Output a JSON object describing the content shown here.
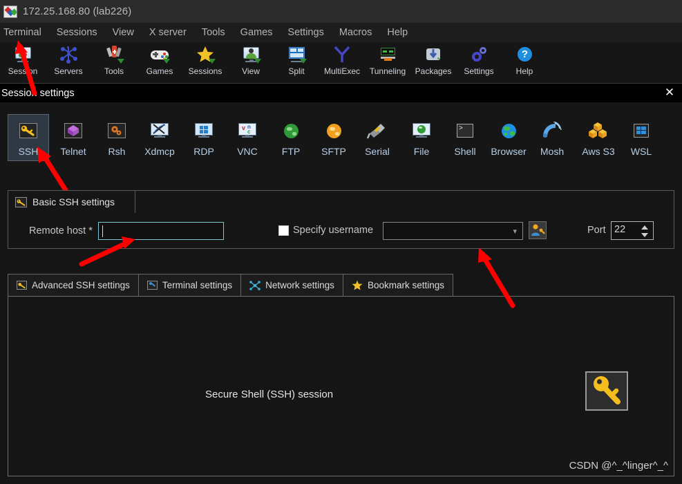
{
  "window": {
    "title": "172.25.168.80 (lab226)",
    "app_icon": "mobaxterm-logo-icon"
  },
  "menubar": {
    "items": [
      {
        "label": "Terminal"
      },
      {
        "label": "Sessions"
      },
      {
        "label": "View"
      },
      {
        "label": "X server"
      },
      {
        "label": "Tools"
      },
      {
        "label": "Games"
      },
      {
        "label": "Settings"
      },
      {
        "label": "Macros"
      },
      {
        "label": "Help"
      }
    ]
  },
  "toolbar": {
    "buttons": [
      {
        "label": "Session",
        "icon": "session-monitor-icon"
      },
      {
        "label": "Servers",
        "icon": "servers-network-icon"
      },
      {
        "label": "Tools",
        "icon": "tools-swiss-knife-icon"
      },
      {
        "label": "Games",
        "icon": "games-gamepad-icon"
      },
      {
        "label": "Sessions",
        "icon": "sessions-star-icon"
      },
      {
        "label": "View",
        "icon": "view-monitor-person-icon"
      },
      {
        "label": "Split",
        "icon": "split-panes-icon"
      },
      {
        "label": "MultiExec",
        "icon": "multiexec-fork-icon"
      },
      {
        "label": "Tunneling",
        "icon": "tunneling-arrows-icon"
      },
      {
        "label": "Packages",
        "icon": "packages-download-icon"
      },
      {
        "label": "Settings",
        "icon": "settings-gears-icon"
      },
      {
        "label": "Help",
        "icon": "help-question-icon"
      }
    ]
  },
  "session_dialog": {
    "header_title": "Session settings",
    "close_icon": "close-icon",
    "session_types": [
      {
        "label": "SSH",
        "icon": "ssh-key-icon",
        "selected": true
      },
      {
        "label": "Telnet",
        "icon": "telnet-cube-icon",
        "selected": false
      },
      {
        "label": "Rsh",
        "icon": "rsh-gears-icon",
        "selected": false
      },
      {
        "label": "Xdmcp",
        "icon": "xdmcp-x-monitor-icon",
        "selected": false
      },
      {
        "label": "RDP",
        "icon": "rdp-windows-icon",
        "selected": false
      },
      {
        "label": "VNC",
        "icon": "vnc-monitor-icon",
        "selected": false
      },
      {
        "label": "FTP",
        "icon": "ftp-green-globe-icon",
        "selected": false
      },
      {
        "label": "SFTP",
        "icon": "sftp-orange-globe-icon",
        "selected": false
      },
      {
        "label": "Serial",
        "icon": "serial-plug-icon",
        "selected": false
      },
      {
        "label": "File",
        "icon": "file-globe-monitor-icon",
        "selected": false
      },
      {
        "label": "Shell",
        "icon": "shell-console-icon",
        "selected": false
      },
      {
        "label": "Browser",
        "icon": "browser-globe-icon",
        "selected": false
      },
      {
        "label": "Mosh",
        "icon": "mosh-satellite-icon",
        "selected": false
      },
      {
        "label": "Aws S3",
        "icon": "aws-s3-boxes-icon",
        "selected": false
      },
      {
        "label": "WSL",
        "icon": "wsl-windows-icon",
        "selected": false
      }
    ],
    "basic_group": {
      "tab_label": "Basic SSH settings",
      "tab_icon": "ssh-key-icon",
      "remote_host_label": "Remote host *",
      "remote_host_value": "",
      "specify_username_label": "Specify username",
      "specify_username_checked": false,
      "username_value": "",
      "username_dropdown_icon": "chevron-down-icon",
      "user_credentials_icon": "user-key-icon",
      "port_label": "Port",
      "port_value": "22"
    },
    "subtabs": [
      {
        "label": "Advanced SSH settings",
        "icon": "ssh-key-icon",
        "active": false
      },
      {
        "label": "Terminal settings",
        "icon": "terminal-icon",
        "active": false
      },
      {
        "label": "Network settings",
        "icon": "network-icon",
        "active": false
      },
      {
        "label": "Bookmark settings",
        "icon": "star-icon",
        "active": false
      }
    ],
    "panel": {
      "description": "Secure Shell (SSH) session",
      "big_icon": "ssh-key-icon",
      "watermark": "CSDN @^_^linger^_^"
    }
  },
  "annotations": {
    "accent_color": "#ff0000",
    "arrows": [
      {
        "name": "arrow-to-session-button"
      },
      {
        "name": "arrow-to-remote-host-field"
      },
      {
        "name": "arrow-to-username-field"
      }
    ]
  },
  "colors": {
    "window_bg": "#151515",
    "titlebar_bg": "#2b2b2b",
    "header_bg": "#000000",
    "selected_tile": "#2f3943",
    "input_focus_border": "#7fc7d6",
    "label_blue": "#b7cfe6"
  }
}
